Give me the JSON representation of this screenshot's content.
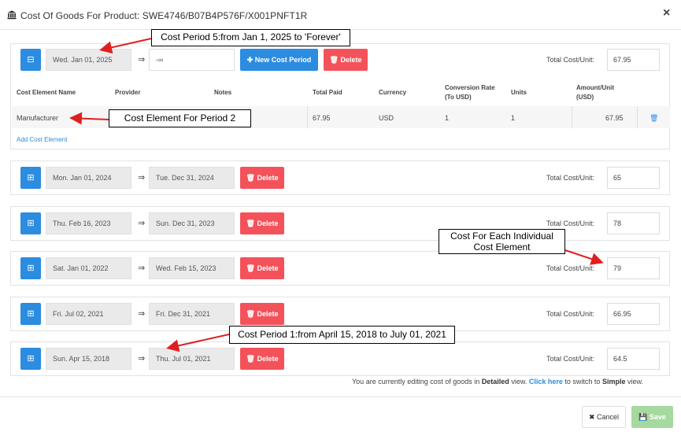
{
  "header": {
    "title": "Cost Of Goods For Product: SWE4746/B07B4P576F/X001PNFT1R",
    "icon": "bank-icon",
    "close": "×"
  },
  "periods": [
    {
      "start": "Wed. Jan 01, 2025",
      "end": "-∞",
      "new_cost_period": "New Cost Period",
      "delete": "Delete",
      "total_label": "Total Cost/Unit:",
      "total": "67.95",
      "expanded": true
    },
    {
      "start": "Mon. Jan 01, 2024",
      "end": "Tue. Dec 31, 2024",
      "delete": "Delete",
      "total_label": "Total Cost/Unit:",
      "total": "65"
    },
    {
      "start": "Thu. Feb 16, 2023",
      "end": "Sun. Dec 31, 2023",
      "delete": "Delete",
      "total_label": "Total Cost/Unit:",
      "total": "78"
    },
    {
      "start": "Sat. Jan 01, 2022",
      "end": "Wed. Feb 15, 2023",
      "delete": "Delete",
      "total_label": "Total Cost/Unit:",
      "total": "79"
    },
    {
      "start": "Fri. Jul 02, 2021",
      "end": "Fri. Dec 31, 2021",
      "delete": "Delete",
      "total_label": "Total Cost/Unit:",
      "total": "66.95"
    },
    {
      "start": "Sun. Apr 15, 2018",
      "end": "Thu. Jul 01, 2021",
      "delete": "Delete",
      "total_label": "Total Cost/Unit:",
      "total": "64.5"
    }
  ],
  "table": {
    "headers": {
      "name": "Cost Element Name",
      "provider": "Provider",
      "notes": "Notes",
      "total_paid": "Total Paid",
      "currency": "Currency",
      "conversion_1": "Conversion Rate",
      "conversion_2": "(To USD)",
      "units": "Units",
      "amount_1": "Amount/Unit",
      "amount_2": "(USD)"
    },
    "row": {
      "name": "Manufacturer",
      "provider": "",
      "notes": "",
      "total_paid": "67.95",
      "currency": "USD",
      "conversion": "1",
      "units": "1",
      "amount": "67.95"
    },
    "add_link": "Add Cost Element"
  },
  "footer": {
    "note_1": "You are currently editing cost of goods in",
    "note_view": "Detailed",
    "note_2": "view.",
    "note_link": "Click here",
    "note_3": "to switch to",
    "note_simple": "Simple",
    "note_4": "view.",
    "cancel": "Cancel",
    "save": "Save"
  },
  "annotations": {
    "period5": "Cost Period 5:from Jan 1, 2025 to 'Forever'",
    "element": "Cost Element For Period 2",
    "each": "Cost For Each Individual",
    "each2": "Cost Element",
    "period1": "Cost Period 1:from April 15, 2018 to July 01, 2021"
  },
  "colors": {
    "primary": "#2b8ce0",
    "danger": "#f4525a",
    "success": "#a6d9a0",
    "annotation_arrow": "#e02020"
  }
}
